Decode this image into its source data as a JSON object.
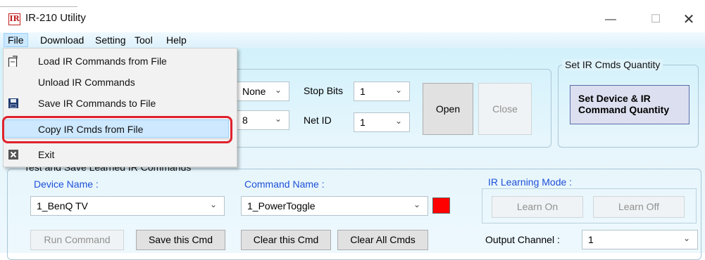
{
  "window": {
    "title": "IR-210 Utility",
    "logo_text": "IR",
    "minimize_glyph": "—",
    "maximize_glyph": "☐",
    "close_glyph": "✕"
  },
  "menubar": [
    "File",
    "Download",
    "Setting",
    "Tool",
    "Help"
  ],
  "file_menu": {
    "items": [
      {
        "label": "Load IR Commands from File",
        "icon": "open-file-icon"
      },
      {
        "label": "Unload IR Commands",
        "icon": ""
      },
      {
        "label": "Save IR Commands to File",
        "icon": "save-disk-icon"
      },
      {
        "label": "Copy IR Cmds from File",
        "icon": "copy-icon",
        "highlighted": true
      },
      {
        "label": "Exit",
        "icon": "exit-x-icon"
      }
    ]
  },
  "serial": {
    "parity": "None",
    "stop_bits_label": "Stop Bits",
    "stop_bits": "1",
    "data_bits": "8",
    "net_id_label": "Net ID",
    "net_id": "1",
    "open_label": "Open",
    "close_label": "Close"
  },
  "quantity": {
    "group_label": "Set IR Cmds Quantity",
    "button_line1": "Set Device & IR",
    "button_line2": "Command Quantity"
  },
  "learn": {
    "group_label": "Test and Save Learned IR Commands",
    "device_label": "Device Name :",
    "device_value": "1_BenQ TV",
    "command_label": "Command Name :",
    "command_value": "1_PowerToggle",
    "indicator_color": "#ff0000",
    "ir_mode_label": "IR Learning Mode :",
    "learn_on": "Learn On",
    "learn_off": "Learn Off",
    "run_command": "Run Command",
    "save_cmd": "Save this Cmd",
    "clear_cmd": "Clear this Cmd",
    "clear_all": "Clear All Cmds",
    "output_label": "Output Channel :",
    "output_value": "1"
  },
  "colors": {
    "accent_red": "#e0222d",
    "label_blue": "#1d4fd8",
    "menu_highlight": "#cde8ff"
  }
}
